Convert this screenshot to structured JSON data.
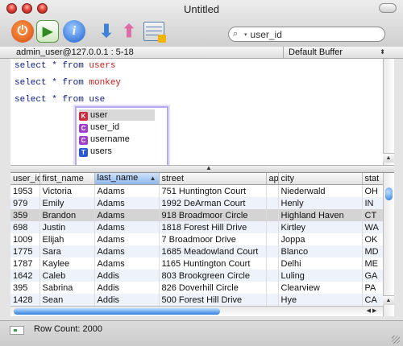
{
  "window": {
    "title": "Untitled"
  },
  "toolbar": {
    "search": {
      "value": "user_id",
      "placeholder": ""
    }
  },
  "info_bar": {
    "connection": "admin_user@127.0.0.1 : 5-18",
    "buffer": "Default Buffer"
  },
  "editor": {
    "lines": [
      {
        "keyword": "select * from ",
        "object": "users"
      },
      {
        "keyword": "select * from ",
        "object": "monkey"
      },
      {
        "keyword": "select * from use",
        "object": ""
      }
    ]
  },
  "autocomplete": {
    "items": [
      {
        "badge": "K",
        "label": "user",
        "color": "#d0283c",
        "selected": true
      },
      {
        "badge": "C",
        "label": "user_id",
        "color": "#a23fcf",
        "selected": false
      },
      {
        "badge": "C",
        "label": "username",
        "color": "#a23fcf",
        "selected": false
      },
      {
        "badge": "T",
        "label": "users",
        "color": "#2b58d6",
        "selected": false
      }
    ]
  },
  "results": {
    "columns": [
      "user_id",
      "first_name",
      "last_name",
      "street",
      "ap",
      "city",
      "stat"
    ],
    "sorted_column": "last_name",
    "rows": [
      [
        "1953",
        "Victoria",
        "Adams",
        "751 Huntington Court",
        "",
        "Niederwald",
        "OH"
      ],
      [
        "979",
        "Emily",
        "Adams",
        "1992 DeArman Court",
        "",
        "Henly",
        "IN"
      ],
      [
        "359",
        "Brandon",
        "Adams",
        "918 Broadmoor Circle",
        "",
        "Highland Haven",
        "CT"
      ],
      [
        "698",
        "Justin",
        "Adams",
        "1818 Forest Hill Drive",
        "",
        "Kirtley",
        "WA"
      ],
      [
        "1009",
        "Elijah",
        "Adams",
        "7 Broadmoor Drive",
        "",
        "Joppa",
        "OK"
      ],
      [
        "1775",
        "Sara",
        "Adams",
        "1685 Meadowland Court",
        "",
        "Blanco",
        "MD"
      ],
      [
        "1787",
        "Kaylee",
        "Adams",
        "1165 Huntington Court",
        "",
        "Delhi",
        "ME"
      ],
      [
        "1642",
        "Caleb",
        "Addis",
        "803 Brookgreen Circle",
        "",
        "Luling",
        "GA"
      ],
      [
        "395",
        "Sabrina",
        "Addis",
        "826 Doverhill Circle",
        "",
        "Clearview",
        "PA"
      ],
      [
        "1428",
        "Sean",
        "Addis",
        "500 Forest Hill Drive",
        "",
        "Hye",
        "CA"
      ]
    ],
    "highlighted_row": 2
  },
  "status": {
    "row_count": "Row Count: 2000"
  }
}
